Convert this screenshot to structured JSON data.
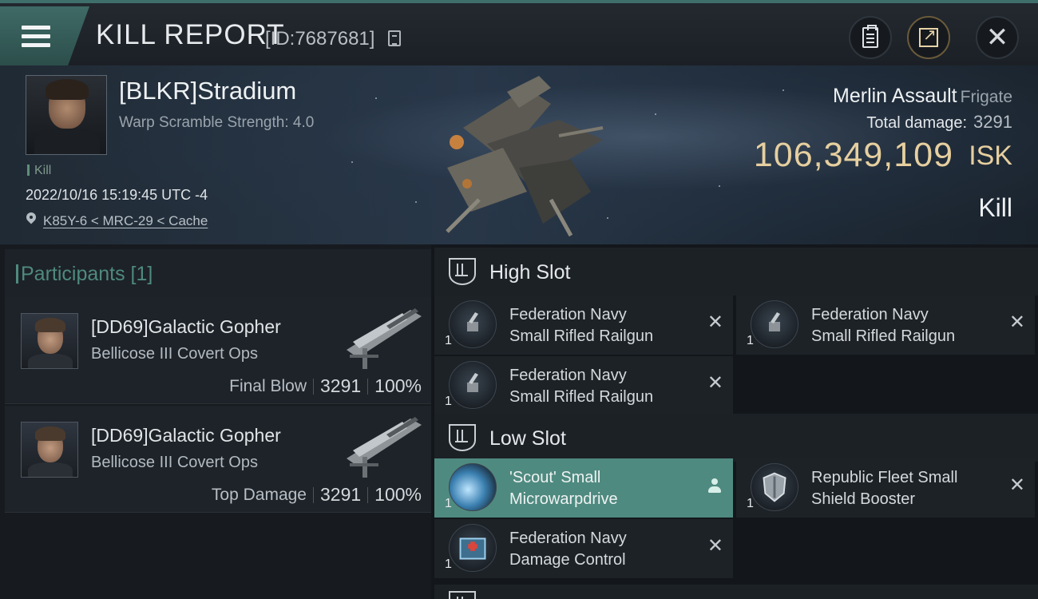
{
  "header": {
    "title": "KILL REPORT",
    "report_id": "[ID:7687681]"
  },
  "victim": {
    "name": "[BLKR]Stradium",
    "subtitle": "Warp Scramble Strength: 4.0",
    "tag": "Kill",
    "datetime": "2022/10/16 15:19:45 UTC -4",
    "location": "K85Y-6 < MRC-29 < Cache",
    "ship_name": "Merlin Assault",
    "ship_class": "Frigate",
    "total_damage_label": "Total damage:",
    "total_damage": "3291",
    "isk_value": "106,349,109",
    "isk_unit": "ISK",
    "outcome": "Kill"
  },
  "participants": {
    "header": "Participants [1]",
    "items": [
      {
        "name": "[DD69]Galactic Gopher",
        "ship": "Bellicose III Covert Ops",
        "role": "Final Blow",
        "damage": "3291",
        "percent": "100%"
      },
      {
        "name": "[DD69]Galactic Gopher",
        "ship": "Bellicose III Covert Ops",
        "role": "Top Damage",
        "damage": "3291",
        "percent": "100%"
      }
    ]
  },
  "fitting": {
    "high_slot": {
      "label": "High Slot",
      "modules": [
        {
          "line1": "Federation Navy",
          "line2": "Small Rifled Railgun",
          "qty": "1",
          "status": "destroyed"
        },
        {
          "line1": "Federation Navy",
          "line2": "Small Rifled Railgun",
          "qty": "1",
          "status": "destroyed"
        },
        {
          "line1": "Federation Navy",
          "line2": "Small Rifled Railgun",
          "qty": "1",
          "status": "destroyed"
        }
      ]
    },
    "low_slot": {
      "label": "Low Slot",
      "modules": [
        {
          "line1": "'Scout' Small",
          "line2": "Microwarpdrive",
          "qty": "1",
          "status": "dropped"
        },
        {
          "line1": "Republic Fleet Small",
          "line2": "Shield Booster",
          "qty": "1",
          "status": "destroyed"
        },
        {
          "line1": "Federation Navy",
          "line2": "Damage Control",
          "qty": "1",
          "status": "destroyed"
        }
      ]
    },
    "destroyed_glyph": "✕"
  },
  "colors": {
    "accent_teal": "#4f8a80",
    "isk_gold": "#e6cf9f",
    "panel_dark": "#1d2227"
  },
  "icons": {
    "menu": "hamburger-menu-icon",
    "copy": "copy-icon",
    "clipboard": "clipboard-icon",
    "export": "export-icon",
    "close": "close-icon",
    "location": "location-pin-icon",
    "slot": "slot-rack-icon",
    "destroyed": "close-icon",
    "dropped": "person-icon"
  }
}
